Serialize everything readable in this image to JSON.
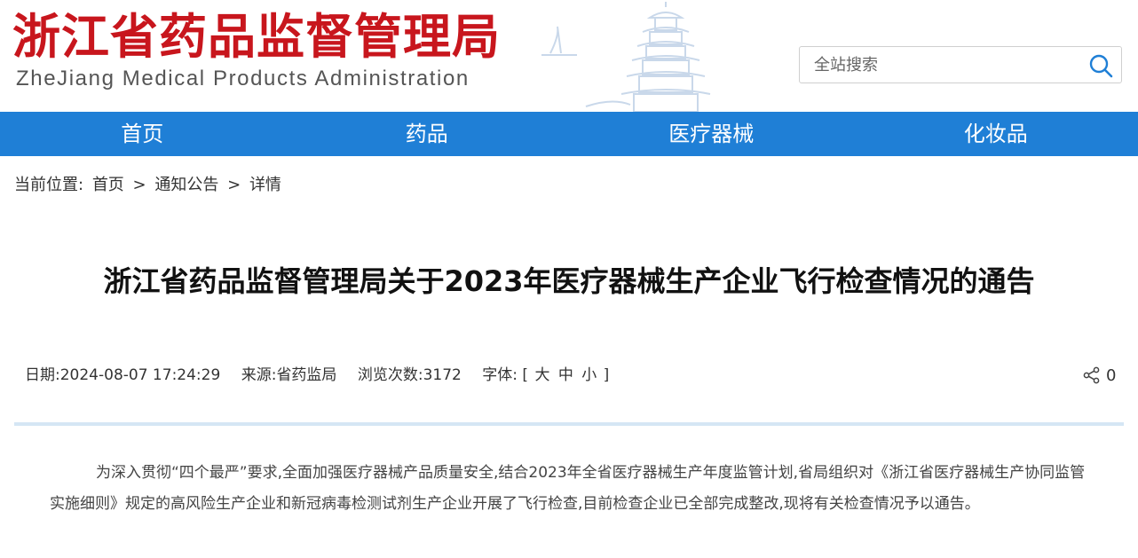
{
  "header": {
    "logo_cn": "浙江省药品监督管理局",
    "logo_en": "ZheJiang Medical Products Administration",
    "search_placeholder": "全站搜索"
  },
  "nav": {
    "items": [
      {
        "label": "首页"
      },
      {
        "label": "药品"
      },
      {
        "label": "医疗器械"
      },
      {
        "label": "化妆品"
      }
    ]
  },
  "breadcrumb": {
    "prefix": "当前位置:",
    "items": [
      "首页",
      "通知公告",
      "详情"
    ],
    "separator": ">"
  },
  "article": {
    "title": "浙江省药品监督管理局关于2023年医疗器械生产企业飞行检查情况的通告",
    "meta": {
      "date_label": "日期:",
      "date": "2024-08-07 17:24:29",
      "source_label": "来源:",
      "source": "省药监局",
      "views_label": "浏览次数:",
      "views": "3172",
      "font_label": "字体:",
      "bracket_open": "[",
      "font_large": "大",
      "font_medium": "中",
      "font_small": "小",
      "bracket_close": "]"
    },
    "share_count": "0",
    "paragraph": "为深入贯彻“四个最严”要求,全面加强医疗器械产品质量安全,结合2023年全省医疗器械生产年度监管计划,省局组织对《浙江省医疗器械生产协同监管实施细则》规定的高风险生产企业和新冠病毒检测试剂生产企业开展了飞行检查,目前检查企业已全部完成整改,现将有关检查情况予以通告。"
  },
  "icons": {
    "search": "search-icon",
    "share": "share-icon",
    "decoration": "pagoda-watermark"
  },
  "colors": {
    "brand_red": "#c8161d",
    "nav_blue": "#1f7fd6",
    "divider": "#d5e6f4"
  }
}
